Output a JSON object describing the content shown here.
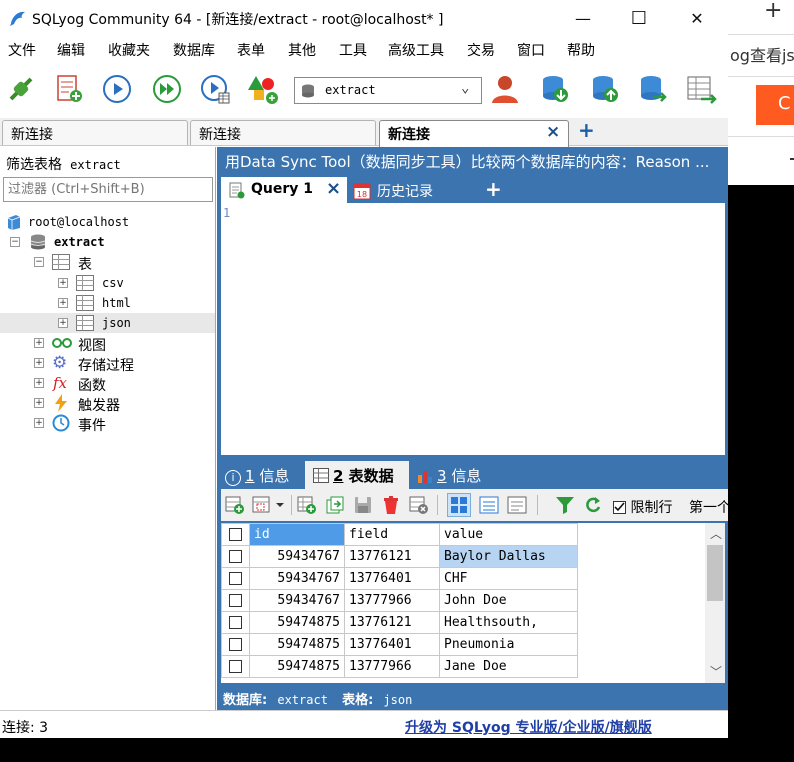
{
  "window": {
    "title": "SQLyog Community 64 - [新连接/extract - root@localhost* ]",
    "minimize_glyph": "—",
    "maximize_glyph": "☐",
    "close_glyph": "✕"
  },
  "menu": [
    "文件",
    "编辑",
    "收藏夹",
    "数据库",
    "表单",
    "其他",
    "工具",
    "高级工具",
    "交易",
    "窗口",
    "帮助"
  ],
  "toolbar": {
    "database_selector": "extract"
  },
  "connection_tabs": [
    {
      "label": "新连接",
      "active": false
    },
    {
      "label": "新连接",
      "active": false
    },
    {
      "label": "新连接",
      "active": true
    }
  ],
  "connection_tab_close": "×",
  "connection_tab_add": "+",
  "left": {
    "filter_label": "筛选表格",
    "filter_db": "extract",
    "filter_placeholder": "过滤器 (Ctrl+Shift+B)",
    "host": "root@localhost",
    "database": "extract",
    "tables_folder": "表",
    "tables": [
      "csv",
      "html",
      "json"
    ],
    "views": "视图",
    "procedures": "存储过程",
    "functions": "函数",
    "triggers": "触发器",
    "events": "事件"
  },
  "right": {
    "banner": "用Data Sync Tool（数据同步工具）比较两个数据库的内容：Reason ...",
    "query_tab": "Query 1",
    "query_close": "×",
    "history_tab": "历史记录",
    "add_tab": "+",
    "editor_line": "1",
    "result_tabs": [
      {
        "num": "1",
        "label": "信息"
      },
      {
        "num": "2",
        "label": "表数据"
      },
      {
        "num": "3",
        "label": "信息"
      }
    ],
    "limit_rows_label": "限制行",
    "first_row_label": "第一个"
  },
  "grid": {
    "columns": [
      "id",
      "field",
      "value"
    ],
    "rows": [
      {
        "id": "59434767",
        "field": "13776121",
        "value": "Baylor Dallas"
      },
      {
        "id": "59434767",
        "field": "13776401",
        "value": "CHF"
      },
      {
        "id": "59434767",
        "field": "13777966",
        "value": "John Doe"
      },
      {
        "id": "59474875",
        "field": "13776121",
        "value": "Healthsouth,"
      },
      {
        "id": "59474875",
        "field": "13776401",
        "value": "Pneumonia"
      },
      {
        "id": "59474875",
        "field": "13777966",
        "value": "Jane Doe"
      }
    ]
  },
  "statusbar_inner": {
    "db_label": "数据库:",
    "db_value": "extract",
    "table_label": "表格:",
    "table_value": "json"
  },
  "statusbar": {
    "connections": "连接: 3",
    "upgrade": "升级为 SQLyog 专业版/企业版/旗舰版"
  },
  "background_window": {
    "plus": "+",
    "text": "og查看js"
  },
  "colors": {
    "accent_blue": "#3c74b0",
    "selected_cell": "#b7d5f2",
    "header_selected": "#4f9be8",
    "upgrade_link": "#1f3fa6",
    "orange": "#ff5a1f"
  }
}
